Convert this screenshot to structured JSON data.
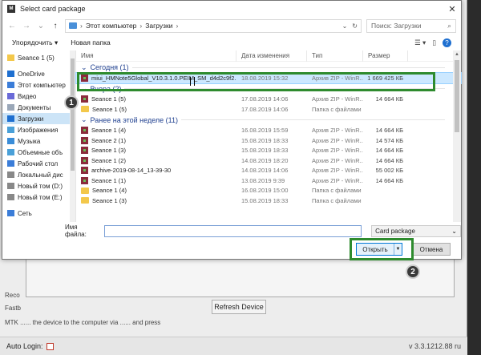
{
  "dialog": {
    "title": "Select card package",
    "close_glyph": "✕",
    "breadcrumb": [
      "Этот компьютер",
      "Загрузки"
    ],
    "search_placeholder": "Поиск: Загрузки",
    "toolbar": {
      "organize": "Упорядочить ▾",
      "new_folder": "Новая папка"
    },
    "nav_items": [
      {
        "label": "Seance 1 (5)",
        "icon": "folder-icon",
        "color": "#f3c84b"
      },
      {
        "label": "OneDrive",
        "icon": "cloud-icon",
        "color": "#1e6fd0"
      },
      {
        "label": "Этот компьютер",
        "icon": "computer-icon",
        "color": "#3b7dd8"
      },
      {
        "label": "Видео",
        "icon": "video-icon",
        "color": "#6a6ad8"
      },
      {
        "label": "Документы",
        "icon": "documents-icon",
        "color": "#9aa7b8"
      },
      {
        "label": "Загрузки",
        "icon": "downloads-icon",
        "color": "#1e6fd0",
        "selected": true
      },
      {
        "label": "Изображения",
        "icon": "images-icon",
        "color": "#4aa0d8"
      },
      {
        "label": "Музыка",
        "icon": "music-icon",
        "color": "#3a8dd8"
      },
      {
        "label": "Объемные объ",
        "icon": "3d-objects-icon",
        "color": "#4aa0d8"
      },
      {
        "label": "Рабочий стол",
        "icon": "desktop-icon",
        "color": "#3b7dd8"
      },
      {
        "label": "Локальный дис",
        "icon": "drive-icon",
        "color": "#888888"
      },
      {
        "label": "Новый том (D:)",
        "icon": "drive-icon",
        "color": "#888888"
      },
      {
        "label": "Новый том (E:)",
        "icon": "drive-icon",
        "color": "#888888"
      },
      {
        "label": "Сеть",
        "icon": "network-icon",
        "color": "#3b7dd8"
      }
    ],
    "columns": {
      "name": "Имя",
      "date": "Дата изменения",
      "type": "Тип",
      "size": "Размер"
    },
    "groups": [
      {
        "header": "Сегодня (1)",
        "rows": [
          {
            "name": "miui_HMNote5Global_V10.3.1.0.PEIM_SM_d4d2c9f2...",
            "date": "18.08.2019 15:32",
            "type": "Архив ZIP - WinR...",
            "size": "1 669 425 КБ",
            "kind": "zip",
            "selected": true
          }
        ]
      },
      {
        "header": "Вчера (2)",
        "rows": [
          {
            "name": "Seance 1 (5)",
            "date": "17.08.2019 14:06",
            "type": "Архив ZIP - WinR...",
            "size": "14 664 КБ",
            "kind": "zip"
          },
          {
            "name": "Seance 1 (5)",
            "date": "17.08.2019 14:06",
            "type": "Папка с файлами",
            "size": "",
            "kind": "folder"
          }
        ]
      },
      {
        "header": "Ранее на этой неделе (11)",
        "rows": [
          {
            "name": "Seance 1 (4)",
            "date": "16.08.2019 15:59",
            "type": "Архив ZIP - WinR...",
            "size": "14 664 КБ",
            "kind": "zip"
          },
          {
            "name": "Seance 2 (1)",
            "date": "15.08.2019 18:33",
            "type": "Архив ZIP - WinR...",
            "size": "14 574 КБ",
            "kind": "zip"
          },
          {
            "name": "Seance 1 (3)",
            "date": "15.08.2019 18:33",
            "type": "Архив ZIP - WinR...",
            "size": "14 664 КБ",
            "kind": "zip"
          },
          {
            "name": "Seance 1 (2)",
            "date": "14.08.2019 18:20",
            "type": "Архив ZIP - WinR...",
            "size": "14 664 КБ",
            "kind": "zip"
          },
          {
            "name": "archive-2019-08-14_13-39-30",
            "date": "14.08.2019 14:06",
            "type": "Архив ZIP - WinR...",
            "size": "55 002 КБ",
            "kind": "zip"
          },
          {
            "name": "Seance 1 (1)",
            "date": "13.08.2019 9:39",
            "type": "Архив ZIP - WinR...",
            "size": "14 664 КБ",
            "kind": "zip"
          },
          {
            "name": "Seance 1 (4)",
            "date": "16.08.2019 15:00",
            "type": "Папка с файлами",
            "size": "",
            "kind": "folder"
          },
          {
            "name": "Seance 1 (3)",
            "date": "15.08.2019 18:33",
            "type": "Папка с файлами",
            "size": "",
            "kind": "folder"
          }
        ]
      }
    ],
    "filename_label": "Имя файла:",
    "filename_value": "",
    "filter_value": "Card package",
    "open_label": "Открыть",
    "cancel_label": "Отмена"
  },
  "annotations": {
    "badge1": "1",
    "badge2": "2",
    "highlight_color": "#2e8b2e"
  },
  "background_app": {
    "reco": "Reco",
    "fastb": "Fastb",
    "mtk_text": "MTK ...... the device to the computer via ...... and press",
    "refresh_label": "Refresh Device",
    "auto_login_label": "Auto Login:",
    "version": "v 3.3.1212.88 ru"
  }
}
